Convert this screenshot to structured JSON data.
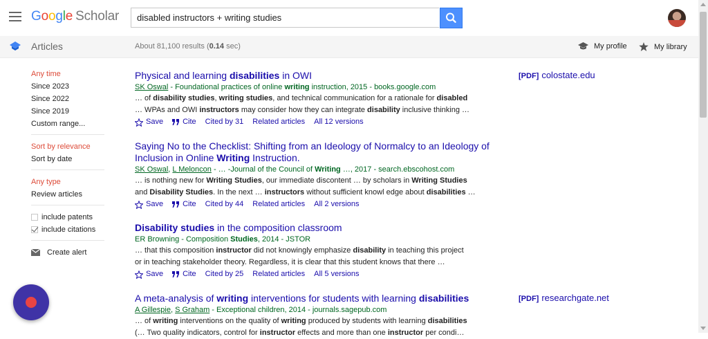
{
  "header": {
    "logo_google": [
      "G",
      "o",
      "o",
      "g",
      "l",
      "e"
    ],
    "logo_scholar": "Scholar",
    "search_value": "disabled instructors + writing studies"
  },
  "subbar": {
    "section_label": "Articles",
    "results_prefix": "About 81,100 results (",
    "results_time": "0.14",
    "results_suffix": " sec)",
    "my_profile": "My profile",
    "my_library": "My library"
  },
  "sidebar": {
    "time_heading": "Any time",
    "time_items": [
      "Since 2023",
      "Since 2022",
      "Since 2019",
      "Custom range..."
    ],
    "sort_heading": "Sort by relevance",
    "sort_items": [
      "Sort by date"
    ],
    "type_heading": "Any type",
    "type_items": [
      "Review articles"
    ],
    "include_patents": "include patents",
    "include_citations": "include citations",
    "create_alert": "Create alert"
  },
  "results": [
    {
      "title_parts": [
        [
          "Physical and learning ",
          false
        ],
        [
          "disabilities",
          true
        ],
        [
          " in OWI",
          false
        ]
      ],
      "authors_parts": [
        [
          "SK Oswal",
          true
        ],
        [
          " - Foundational practices of online ",
          false
        ],
        [
          "writing",
          "b"
        ],
        [
          " instruction, 2015 - books.google.com",
          false
        ]
      ],
      "snippet1": [
        [
          "… of ",
          false
        ],
        [
          "disability studies",
          true
        ],
        [
          ", ",
          false
        ],
        [
          "writing studies",
          true
        ],
        [
          ", and technical communication for a rationale for ",
          false
        ],
        [
          "disabled",
          true
        ]
      ],
      "snippet2": [
        [
          "… WPAs and OWI ",
          false
        ],
        [
          "instructors",
          true
        ],
        [
          " may consider how they can integrate ",
          false
        ],
        [
          "disability",
          true
        ],
        [
          " inclusive thinking …",
          false
        ]
      ],
      "save": "Save",
      "cite": "Cite",
      "cited_by": "Cited by 31",
      "related": "Related articles",
      "versions": "All 12 versions",
      "pdf_tag": "[PDF]",
      "pdf_source": "colostate.edu"
    },
    {
      "title_parts": [
        [
          "Saying No to the Checklist: Shifting from an Ideology of Normalcy to an Ideology of Inclusion in Online ",
          false
        ],
        [
          "Writing",
          true
        ],
        [
          " Instruction.",
          false
        ]
      ],
      "authors_parts": [
        [
          "SK Oswal",
          true
        ],
        [
          ", ",
          false
        ],
        [
          "L Meloncon",
          true
        ],
        [
          " - … -Journal of the Council of ",
          false
        ],
        [
          "Writing",
          "b"
        ],
        [
          " …, 2017 - search.ebscohost.com",
          false
        ]
      ],
      "snippet1": [
        [
          "… is nothing new for ",
          false
        ],
        [
          "Writing Studies",
          true
        ],
        [
          ", our immediate discontent … by scholars in ",
          false
        ],
        [
          "Writing Studies",
          true
        ]
      ],
      "snippet2": [
        [
          "and ",
          false
        ],
        [
          "Disability Studies",
          true
        ],
        [
          ". In the next … ",
          false
        ],
        [
          "instructors",
          true
        ],
        [
          " without sufficient knowl edge about ",
          false
        ],
        [
          "disabilities",
          true
        ],
        [
          " …",
          false
        ]
      ],
      "save": "Save",
      "cite": "Cite",
      "cited_by": "Cited by 44",
      "related": "Related articles",
      "versions": "All 2 versions"
    },
    {
      "title_parts": [
        [
          "Disability studies",
          true
        ],
        [
          " in the composition classroom",
          false
        ]
      ],
      "authors_parts": [
        [
          "ER Browning - Composition ",
          false
        ],
        [
          "Studies",
          "b"
        ],
        [
          ", 2014 - JSTOR",
          false
        ]
      ],
      "snippet1": [
        [
          "… that this composition ",
          false
        ],
        [
          "instructor",
          true
        ],
        [
          " did not knowingly emphasize ",
          false
        ],
        [
          "disability",
          true
        ],
        [
          " in teaching this project",
          false
        ]
      ],
      "snippet2": [
        [
          "or in teaching stakeholder theory. Regardless, it is clear that this student knows that there …",
          false
        ]
      ],
      "save": "Save",
      "cite": "Cite",
      "cited_by": "Cited by 25",
      "related": "Related articles",
      "versions": "All 5 versions"
    },
    {
      "title_parts": [
        [
          "A meta-analysis of ",
          false
        ],
        [
          "writing",
          true
        ],
        [
          " interventions for students with learning ",
          false
        ],
        [
          "disabilities",
          true
        ]
      ],
      "authors_parts": [
        [
          "A Gillespie",
          true
        ],
        [
          ", ",
          false
        ],
        [
          "S Graham",
          true
        ],
        [
          " - Exceptional children, 2014 - journals.sagepub.com",
          false
        ]
      ],
      "snippet1": [
        [
          "… of ",
          false
        ],
        [
          "writing",
          true
        ],
        [
          " interventions on the quality of ",
          false
        ],
        [
          "writing",
          true
        ],
        [
          " produced by students with learning ",
          false
        ],
        [
          "disabilities",
          true
        ]
      ],
      "snippet2": [
        [
          "(… Two quality indicators, control for ",
          false
        ],
        [
          "instructor",
          true
        ],
        [
          " effects and more than one ",
          false
        ],
        [
          "instructor",
          true
        ],
        [
          " per condi…",
          false
        ]
      ],
      "pdf_tag": "[PDF]",
      "pdf_source": "researchgate.net"
    }
  ]
}
